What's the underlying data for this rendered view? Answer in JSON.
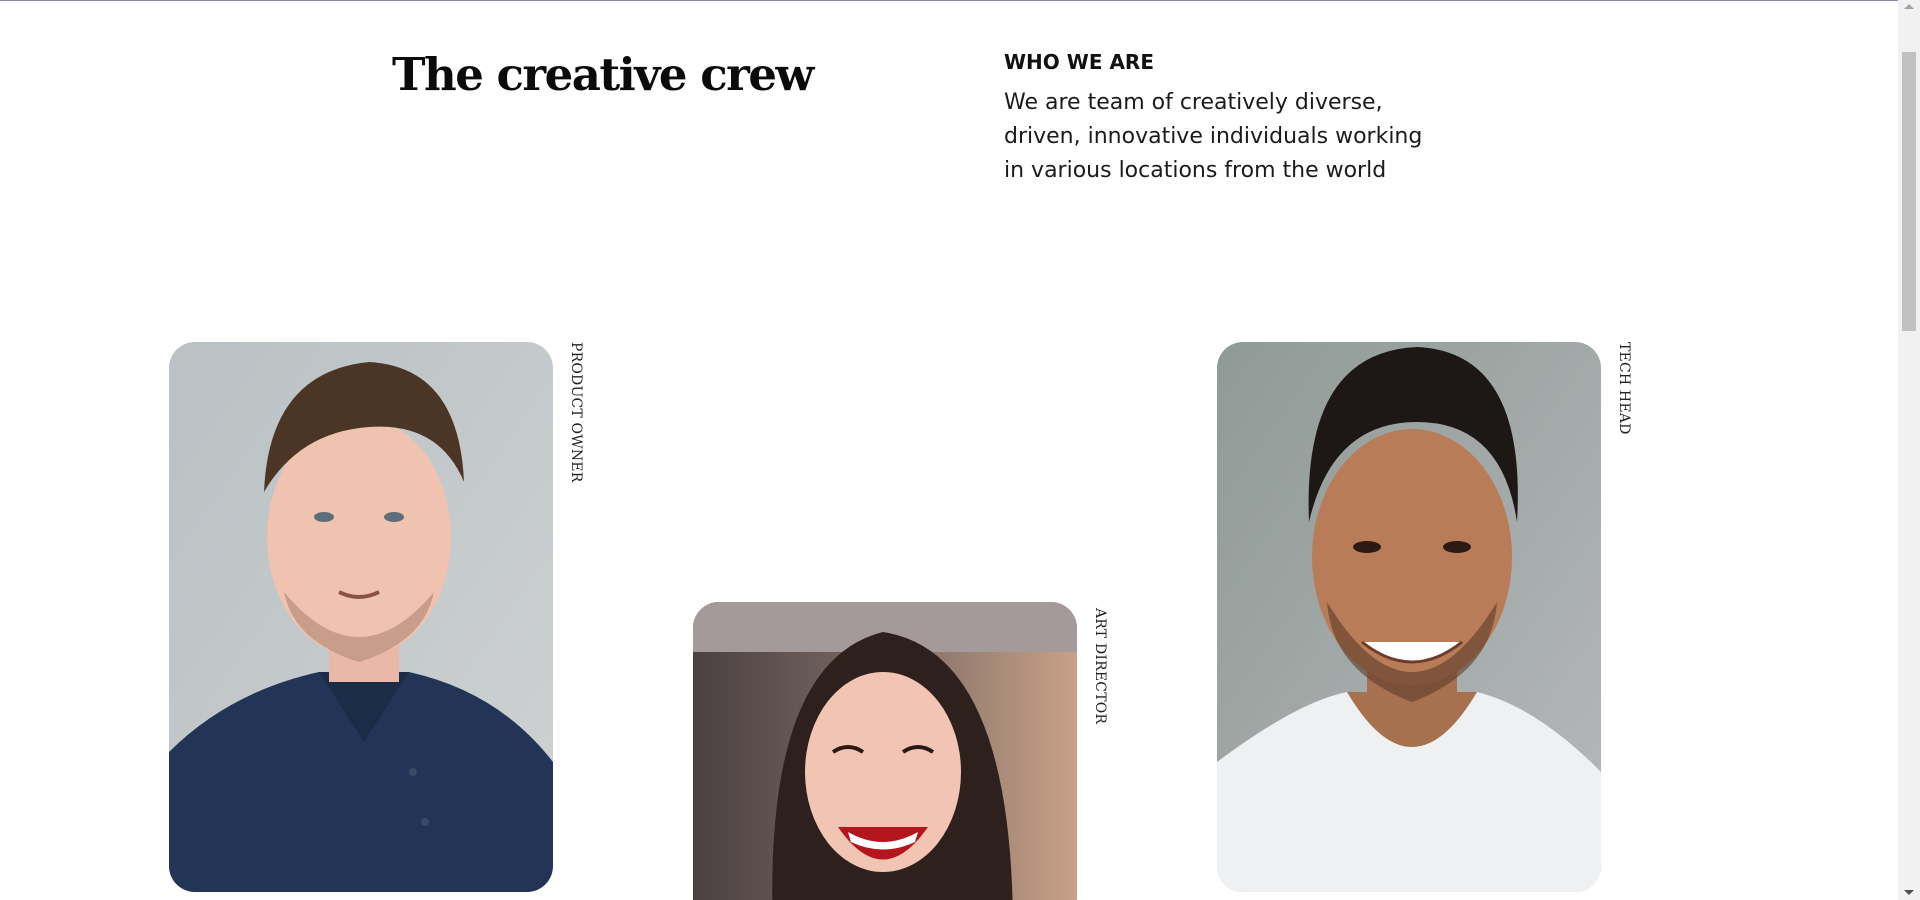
{
  "heading": {
    "title": "The creative crew"
  },
  "about": {
    "eyebrow": "WHO WE ARE",
    "text": "We are team of creatively diverse, driven, innovative individuals working in various locations from the world"
  },
  "team": [
    {
      "role": "PRODUCT OWNER",
      "photo_icon": "portrait-man-navy-polo"
    },
    {
      "role": "ART DIRECTOR",
      "photo_icon": "portrait-woman-laughing"
    },
    {
      "role": "TECH HEAD",
      "photo_icon": "portrait-man-white-tee"
    }
  ]
}
